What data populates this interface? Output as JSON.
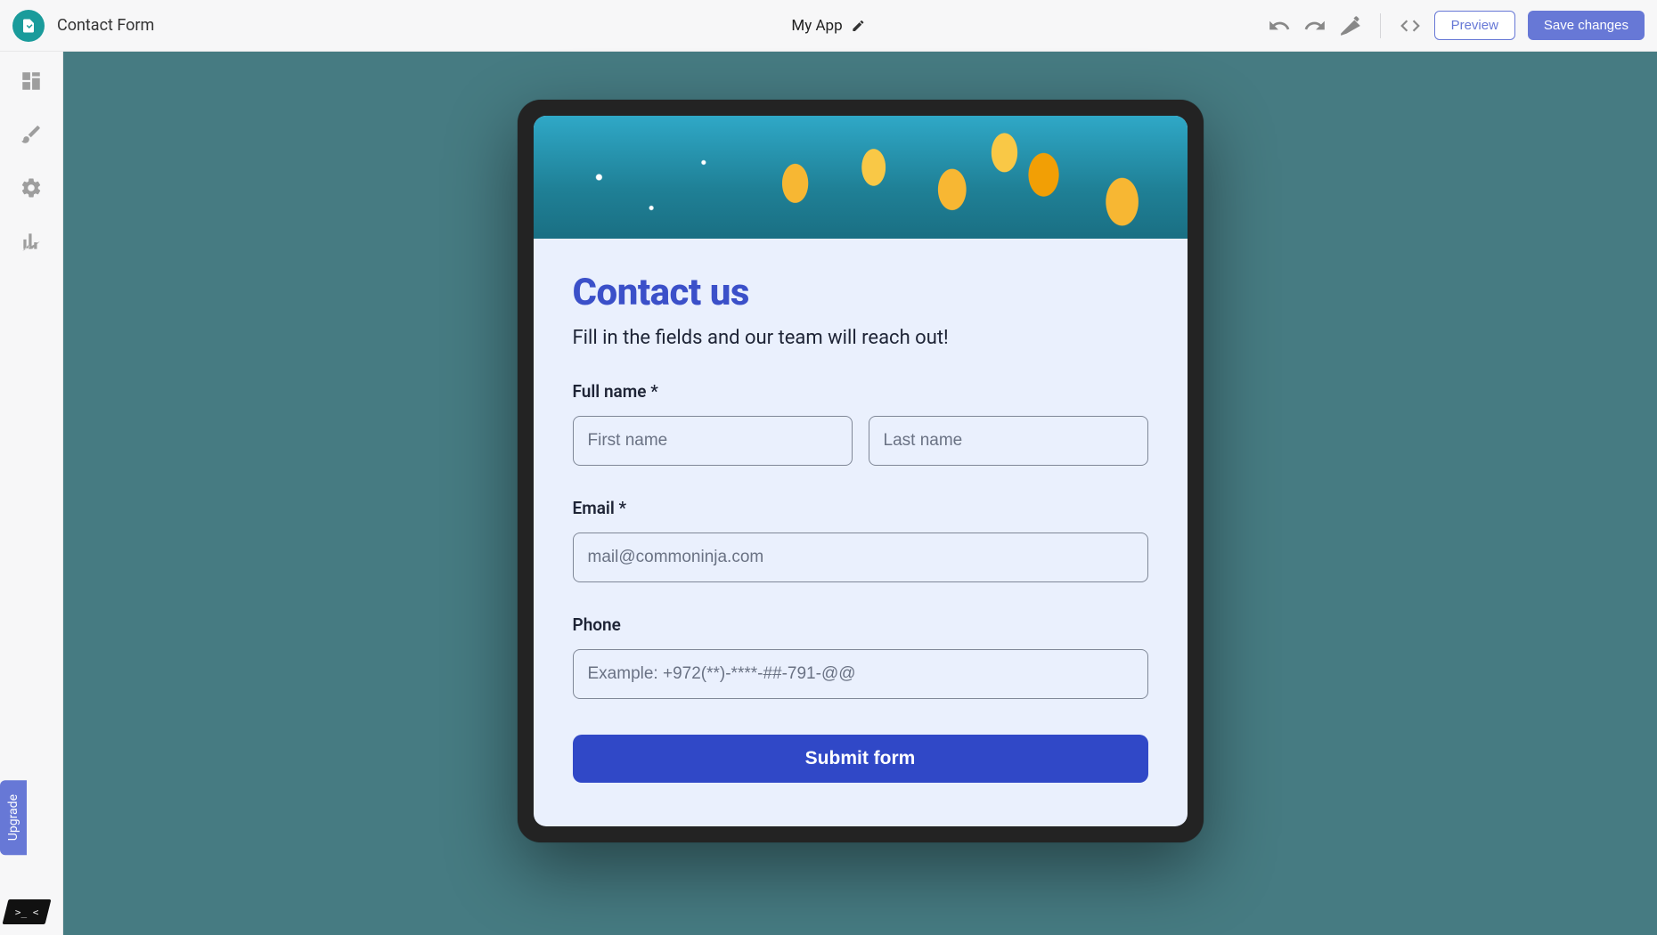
{
  "header": {
    "form_name": "Contact Form",
    "app_name": "My App",
    "preview_label": "Preview",
    "save_label": "Save changes"
  },
  "sidebar": {
    "upgrade_label": "Upgrade"
  },
  "form": {
    "title": "Contact us",
    "subtitle": "Fill in the fields and our team will reach out!",
    "fields": {
      "fullname": {
        "label": "Full name *",
        "first_placeholder": "First name",
        "last_placeholder": "Last name"
      },
      "email": {
        "label": "Email *",
        "placeholder": "mail@commoninja.com"
      },
      "phone": {
        "label": "Phone",
        "placeholder": "Example: +972(**)-****-##-791-@@"
      }
    },
    "submit_label": "Submit form"
  }
}
